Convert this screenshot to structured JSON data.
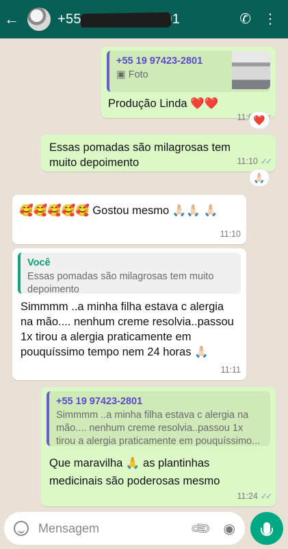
{
  "header": {
    "contact_number": "+55 19 97423-2801",
    "back_icon": "arrow-left-icon",
    "call_icon": "add-call-icon",
    "menu_icon": "more-vert-icon"
  },
  "messages": [
    {
      "direction": "out",
      "quote": {
        "author": "+55 19 97423-2801",
        "text": "Foto"
      },
      "text": "Produção Linda ❤️❤️",
      "time": "11:09",
      "reaction": "❤️"
    },
    {
      "direction": "out",
      "text": "Essas pomadas são milagrosas tem muito depoimento",
      "time": "11:10",
      "reaction": "🙏🏻"
    },
    {
      "direction": "in",
      "text": "🥰🥰🥰🥰🥰 Gostou mesmo 🙏🏻🙏🏻 🙏🏻",
      "time": "11:10"
    },
    {
      "direction": "in",
      "quote": {
        "author": "Você",
        "text": "Essas pomadas são milagrosas tem muito depoimento"
      },
      "text": "Simmmm ..a minha filha estava c alergia na mão.... nenhum creme resolvia..passou 1x tirou a alergia praticamente em pouquíssimo tempo nem 24 horas 🙏🏻",
      "time": "11:11"
    },
    {
      "direction": "out",
      "quote": {
        "author": "+55 19 97423-2801",
        "text": "Simmmm ..a minha filha estava c alergia na mão.... nenhum creme resolvia..passou 1x tirou a alergia praticamente em pouquíssimo..."
      },
      "text": "Que maravilha 🙏 as plantinhas medicinais são poderosas mesmo",
      "time": "11:24"
    }
  ],
  "composer": {
    "placeholder": "Mensagem",
    "emoji_icon": "emoji-icon",
    "attach_icon": "paperclip-icon",
    "camera_icon": "camera-icon",
    "mic_icon": "microphone-icon"
  },
  "colors": {
    "header": "#075e54",
    "outgoing_bubble": "#dcf8c6",
    "incoming_bubble": "#ffffff",
    "chat_background": "#e9e1d6",
    "send_button": "#00a884"
  }
}
